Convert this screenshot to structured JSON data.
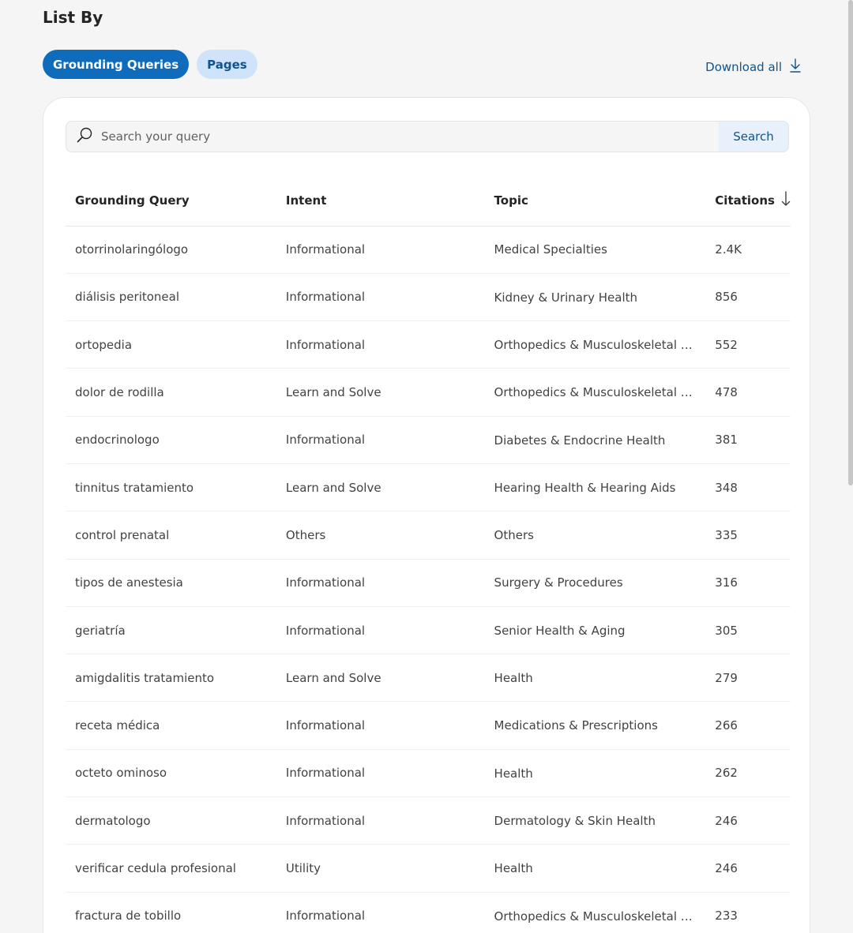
{
  "header": {
    "title": "List By"
  },
  "toggle": {
    "grounding_label": "Grounding Queries",
    "pages_label": "Pages"
  },
  "download": {
    "label": "Download all"
  },
  "search": {
    "placeholder": "Search your query",
    "button_label": "Search"
  },
  "table": {
    "headers": {
      "query": "Grounding Query",
      "intent": "Intent",
      "topic": "Topic",
      "citations": "Citations"
    },
    "sort": {
      "column": "citations",
      "direction": "descending"
    },
    "rows": [
      {
        "query": "otorrinolaringólogo",
        "intent": "Informational",
        "topic": "Medical Specialties",
        "citations": "2.4K"
      },
      {
        "query": "diálisis peritoneal",
        "intent": "Informational",
        "topic": "Kidney & Urinary Health",
        "citations": "856"
      },
      {
        "query": "ortopedia",
        "intent": "Informational",
        "topic": "Orthopedics & Musculoskeletal Heal...",
        "citations": "552"
      },
      {
        "query": "dolor de rodilla",
        "intent": "Learn and Solve",
        "topic": "Orthopedics & Musculoskeletal Heal...",
        "citations": "478"
      },
      {
        "query": "endocrinologo",
        "intent": "Informational",
        "topic": "Diabetes & Endocrine Health",
        "citations": "381"
      },
      {
        "query": "tinnitus tratamiento",
        "intent": "Learn and Solve",
        "topic": "Hearing Health & Hearing Aids",
        "citations": "348"
      },
      {
        "query": "control prenatal",
        "intent": "Others",
        "topic": "Others",
        "citations": "335"
      },
      {
        "query": "tipos de anestesia",
        "intent": "Informational",
        "topic": "Surgery & Procedures",
        "citations": "316"
      },
      {
        "query": "geriatría",
        "intent": "Informational",
        "topic": "Senior Health & Aging",
        "citations": "305"
      },
      {
        "query": "amigdalitis tratamiento",
        "intent": "Learn and Solve",
        "topic": "Health",
        "citations": "279"
      },
      {
        "query": "receta médica",
        "intent": "Informational",
        "topic": "Medications & Prescriptions",
        "citations": "266"
      },
      {
        "query": "octeto ominoso",
        "intent": "Informational",
        "topic": "Health",
        "citations": "262"
      },
      {
        "query": "dermatologo",
        "intent": "Informational",
        "topic": "Dermatology & Skin Health",
        "citations": "246"
      },
      {
        "query": "verificar cedula profesional",
        "intent": "Utility",
        "topic": "Health",
        "citations": "246"
      },
      {
        "query": "fractura de tobillo",
        "intent": "Informational",
        "topic": "Orthopedics & Musculoskeletal Heal...",
        "citations": "233"
      }
    ]
  },
  "colors": {
    "accent": "#0f6cbd",
    "accent_light": "#cfe4fa",
    "link": "#0f548c"
  }
}
